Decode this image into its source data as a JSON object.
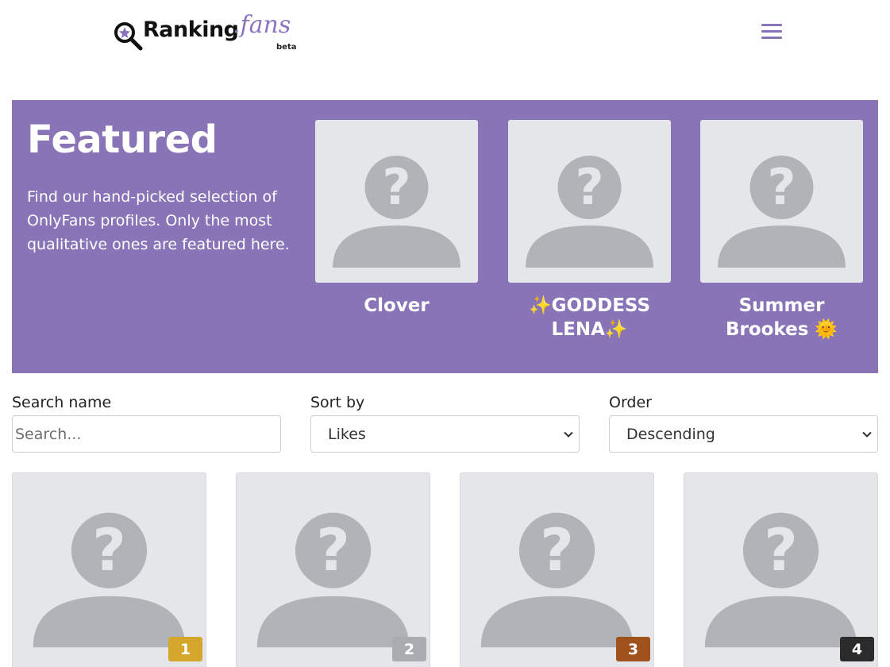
{
  "header": {
    "logo_word": "Ranking",
    "logo_suffix": ".fans",
    "logo_badge": "beta",
    "menu_icon": "hamburger-menu-icon",
    "accent_color": "#8774b8"
  },
  "featured": {
    "title": "Featured",
    "description": "Find our hand-picked selection of OnlyFans profiles. Only the most qualitative ones are featured here.",
    "background_color": "#8874b7",
    "profiles": [
      {
        "name": "Clover",
        "avatar_icon": "placeholder-avatar-icon"
      },
      {
        "name": "✨GODDESS LENA✨",
        "avatar_icon": "placeholder-avatar-icon"
      },
      {
        "name": "Summer Brookes 🌞",
        "avatar_icon": "placeholder-avatar-icon"
      }
    ]
  },
  "filters": {
    "search_label": "Search name",
    "search_placeholder": "Search...",
    "sort_label": "Sort by",
    "sort_value": "Likes",
    "order_label": "Order",
    "order_value": "Descending"
  },
  "grid": {
    "cards": [
      {
        "rank": "1",
        "badge_color": "#d4a72c",
        "avatar_icon": "placeholder-avatar-icon"
      },
      {
        "rank": "2",
        "badge_color": "#a9acb1",
        "avatar_icon": "placeholder-avatar-icon"
      },
      {
        "rank": "3",
        "badge_color": "#a0521d",
        "avatar_icon": "placeholder-avatar-icon"
      },
      {
        "rank": "4",
        "badge_color": "#2b2b2b",
        "avatar_icon": "placeholder-avatar-icon"
      }
    ]
  }
}
